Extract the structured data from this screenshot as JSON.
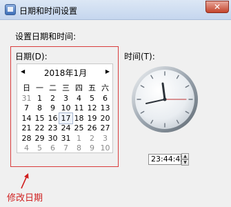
{
  "window": {
    "title": "日期和时间设置",
    "close_label": "✕"
  },
  "heading": "设置日期和时间:",
  "date_label": "日期(D):",
  "time_label": "时间(T):",
  "calendar": {
    "month_label": "2018年1月",
    "prev_label": "◀",
    "next_label": "▶",
    "weekdays": [
      "日",
      "一",
      "二",
      "三",
      "四",
      "五",
      "六"
    ],
    "weeks": [
      [
        "31",
        "1",
        "2",
        "3",
        "4",
        "5",
        "6"
      ],
      [
        "7",
        "8",
        "9",
        "10",
        "11",
        "12",
        "13"
      ],
      [
        "14",
        "15",
        "16",
        "17",
        "18",
        "19",
        "20"
      ],
      [
        "21",
        "22",
        "23",
        "24",
        "25",
        "26",
        "27"
      ],
      [
        "28",
        "29",
        "30",
        "31",
        "1",
        "2",
        "3"
      ],
      [
        "4",
        "5",
        "6",
        "7",
        "8",
        "9",
        "10"
      ]
    ]
  },
  "time_value": "23:44:42",
  "spin_up": "▲",
  "spin_down": "▼",
  "annotation": "修改日期"
}
